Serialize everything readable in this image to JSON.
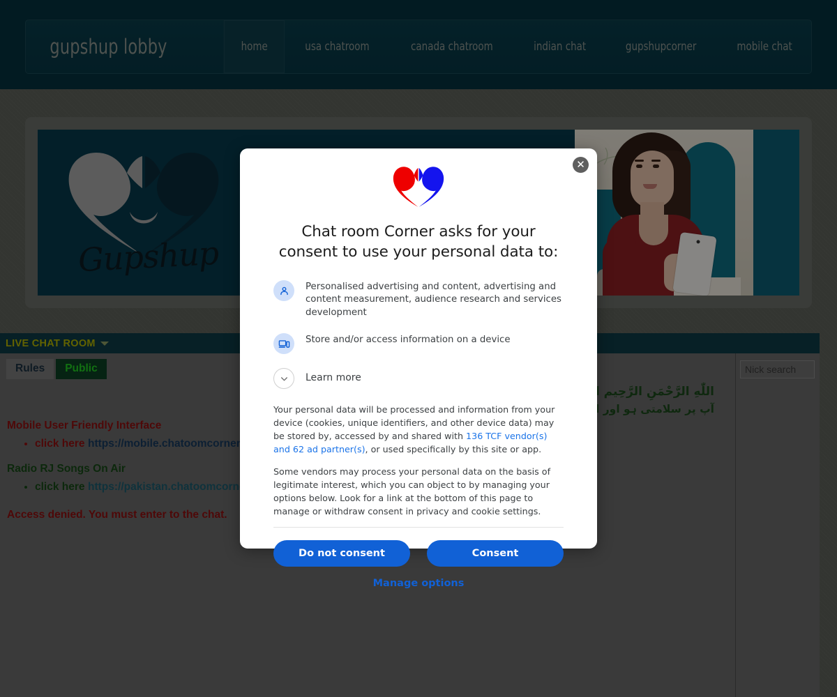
{
  "header": {
    "brand": "gupshup lobby",
    "nav": [
      {
        "label": "home",
        "active": true
      },
      {
        "label": "usa chatroom",
        "active": false
      },
      {
        "label": "canada chatroom",
        "active": false
      },
      {
        "label": "indian chat",
        "active": false
      },
      {
        "label": "gupshupcorner",
        "active": false
      },
      {
        "label": "mobile chat",
        "active": false
      }
    ]
  },
  "banner": {
    "logo_word": "Gupshup",
    "logo_alt": "heart-couple-silhouette",
    "photo_alt": "woman-with-tablet"
  },
  "chat": {
    "titlebar": "LIVE CHAT ROOM",
    "caret": "chevron-down-icon",
    "tabs": [
      {
        "label": "Rules",
        "active": false
      },
      {
        "label": "Public",
        "active": true
      }
    ],
    "messages": {
      "arabic_line": "اللّٰهِ الرَّحْمَنِ الرَّحِيم السلام عليكم ورحمةً الله وبركاته",
      "urdu_line": "آپ پر سلامتی ہو اور اللہ کی رحمتیں اور برکتیں ہوں۔",
      "mobile_heading": "Mobile User Friendly Interface",
      "mobile_click": "click here",
      "mobile_url": "https://mobile.chatoomcorner.c",
      "radio_heading": "Radio RJ Songs On Air",
      "radio_click": "click here",
      "radio_url": "https://pakistan.chatoomcorne",
      "access_denied": "Access denied. You must enter to the chat."
    },
    "side": {
      "nick_search_placeholder": "Nick search",
      "nick_search_value": ""
    }
  },
  "consent_modal": {
    "close_icon": "close-icon",
    "logo_icon": "heart-couple-logo",
    "title": "Chat room Corner asks for your consent to use your personal data to:",
    "purposes": [
      {
        "icon": "person-icon",
        "text": "Personalised advertising and content, advertising and content measurement, audience research and services development"
      },
      {
        "icon": "devices-icon",
        "text": "Store and/or access information on a device"
      }
    ],
    "learn_more": {
      "icon": "chevron-down-icon",
      "label": "Learn more"
    },
    "legal": {
      "p1_before": "Your personal data will be processed and information from your device (cookies, unique identifiers, and other device data) may be stored by, accessed by and shared with ",
      "p1_link": "136 TCF vendor(s) and 62 ad partner(s)",
      "p1_after": ", or used specifically by this site or app.",
      "p2": "Some vendors may process your personal data on the basis of legitimate interest, which you can object to by managing your options below. Look for a link at the bottom of this page to manage or withdraw consent in privacy and cookie settings."
    },
    "buttons": {
      "do_not_consent": "Do not consent",
      "consent": "Consent",
      "manage_options": "Manage options"
    }
  },
  "colors": {
    "header_bg": "#05323f",
    "nav_bg": "#08394699",
    "banner_bg": "#073a4b",
    "page_bg": "#5e615a",
    "chat_titlebar": "#0d3b45",
    "chat_body": "#6b6b6b",
    "title_yellow": "#b4b400",
    "public_green": "#22cc22",
    "accent_blue": "#1161d6",
    "link_blue": "#1a73e8"
  }
}
